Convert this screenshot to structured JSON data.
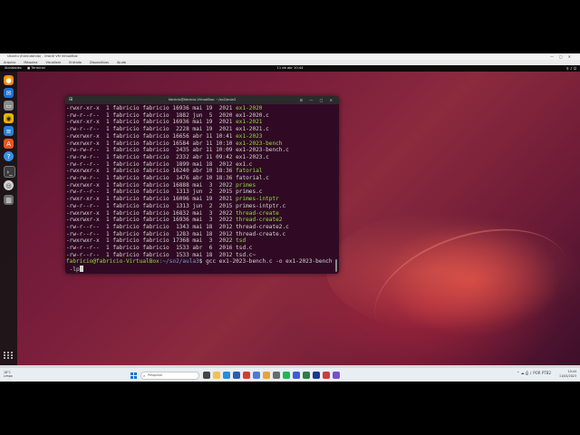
{
  "vbox": {
    "title": "Ubuntu (Executando) - Oracle VM VirtualBox",
    "menu": [
      "Arquivo",
      "Máquina",
      "Visualizar",
      "Entrada",
      "Dispositivos",
      "Ajuda"
    ],
    "host_key": "Right Control"
  },
  "topbar": {
    "activities": "Atividades",
    "app": "Terminal",
    "clock": "11 de abr  10:44"
  },
  "terminal": {
    "title": "fabricio@fabricio-VirtualBox: ~/so2/aula3",
    "lines": [
      {
        "perm": "-rwxr-xr-x",
        "rest": "  1 fabricio fabricio 16936 mai 19  2021 ",
        "name": "ex1-2020",
        "type": "exe"
      },
      {
        "perm": "-rw-r--r--",
        "rest": "  1 fabricio fabricio  1882 jun  5  2020 ",
        "name": "ex1-2020.c",
        "type": "file"
      },
      {
        "perm": "-rwxr-xr-x",
        "rest": "  1 fabricio fabricio 16936 mai 19  2021 ",
        "name": "ex1-2021",
        "type": "exe"
      },
      {
        "perm": "-rw-r--r--",
        "rest": "  1 fabricio fabricio  2228 mai 19  2021 ",
        "name": "ex1-2021.c",
        "type": "file"
      },
      {
        "perm": "-rwxrwxr-x",
        "rest": "  1 fabricio fabricio 16656 abr 11 10:41 ",
        "name": "ex1-2023",
        "type": "exe"
      },
      {
        "perm": "-rwxrwxr-x",
        "rest": "  1 fabricio fabricio 16584 abr 11 10:10 ",
        "name": "ex1-2023-bench",
        "type": "exe"
      },
      {
        "perm": "-rw-rw-r--",
        "rest": "  1 fabricio fabricio  2435 abr 11 10:09 ",
        "name": "ex1-2023-bench.c",
        "type": "file"
      },
      {
        "perm": "-rw-rw-r--",
        "rest": "  1 fabricio fabricio  2332 abr 11 09:42 ",
        "name": "ex1-2023.c",
        "type": "file"
      },
      {
        "perm": "-rw-r--r--",
        "rest": "  1 fabricio fabricio  1899 mai 18  2012 ",
        "name": "ex1.c",
        "type": "file"
      },
      {
        "perm": "-rwxrwxr-x",
        "rest": "  1 fabricio fabricio 16240 abr 10 18:36 ",
        "name": "fatorial",
        "type": "exe"
      },
      {
        "perm": "-rw-rw-r--",
        "rest": "  1 fabricio fabricio  1476 abr 10 18:36 ",
        "name": "fatorial.c",
        "type": "file"
      },
      {
        "perm": "-rwxrwxr-x",
        "rest": "  1 fabricio fabricio 16888 mai  3  2022 ",
        "name": "primes",
        "type": "exe"
      },
      {
        "perm": "-rw-r--r--",
        "rest": "  1 fabricio fabricio  1313 jun  2  2015 ",
        "name": "primes.c",
        "type": "file"
      },
      {
        "perm": "-rwxr-xr-x",
        "rest": "  1 fabricio fabricio 16096 mai 19  2021 ",
        "name": "primes-intptr",
        "type": "exe"
      },
      {
        "perm": "-rw-r--r--",
        "rest": "  1 fabricio fabricio  1313 jun  2  2015 ",
        "name": "primes-intptr.c",
        "type": "file"
      },
      {
        "perm": "-rwxrwxr-x",
        "rest": "  1 fabricio fabricio 16832 mai  3  2022 ",
        "name": "thread-create",
        "type": "exe"
      },
      {
        "perm": "-rwxrwxr-x",
        "rest": "  1 fabricio fabricio 16936 mai  3  2022 ",
        "name": "thread-create2",
        "type": "exe"
      },
      {
        "perm": "-rw-r--r--",
        "rest": "  1 fabricio fabricio  1343 mai 18  2012 ",
        "name": "thread-create2.c",
        "type": "file"
      },
      {
        "perm": "-rw-r--r--",
        "rest": "  1 fabricio fabricio  1283 mai 18  2012 ",
        "name": "thread-create.c",
        "type": "file"
      },
      {
        "perm": "-rwxrwxr-x",
        "rest": "  1 fabricio fabricio 17368 mai  3  2022 ",
        "name": "tsd",
        "type": "exe"
      },
      {
        "perm": "-rw-r--r--",
        "rest": "  1 fabricio fabricio  1533 abr  6  2016 ",
        "name": "tsd.c",
        "type": "file"
      },
      {
        "perm": "-rw-r--r--",
        "rest": "  1 fabricio fabricio  1533 mai 18  2012 ",
        "name": "tsd.c~",
        "type": "file"
      }
    ],
    "prompt_user": "fabricio@fabricio-VirtualBox",
    "prompt_path": ":~/so2/aula3",
    "prompt_sign": "$ ",
    "command": "gcc ex1-2023-bench.c -o ex1-2023-bench",
    "command_cont": " -lp"
  },
  "taskbar": {
    "weather_temp": "18°C",
    "weather_desc": "Limpo",
    "search_placeholder": "Pesquisar",
    "time": "10:44",
    "date": "11/04/2023",
    "lang": "POR PTB2"
  },
  "dock": [
    "firefox-icon",
    "thunderbird-icon",
    "files-icon",
    "rhythmbox-icon",
    "writer-icon",
    "software-icon",
    "help-icon",
    "terminal-icon",
    "disc-icon",
    "trash-icon"
  ]
}
